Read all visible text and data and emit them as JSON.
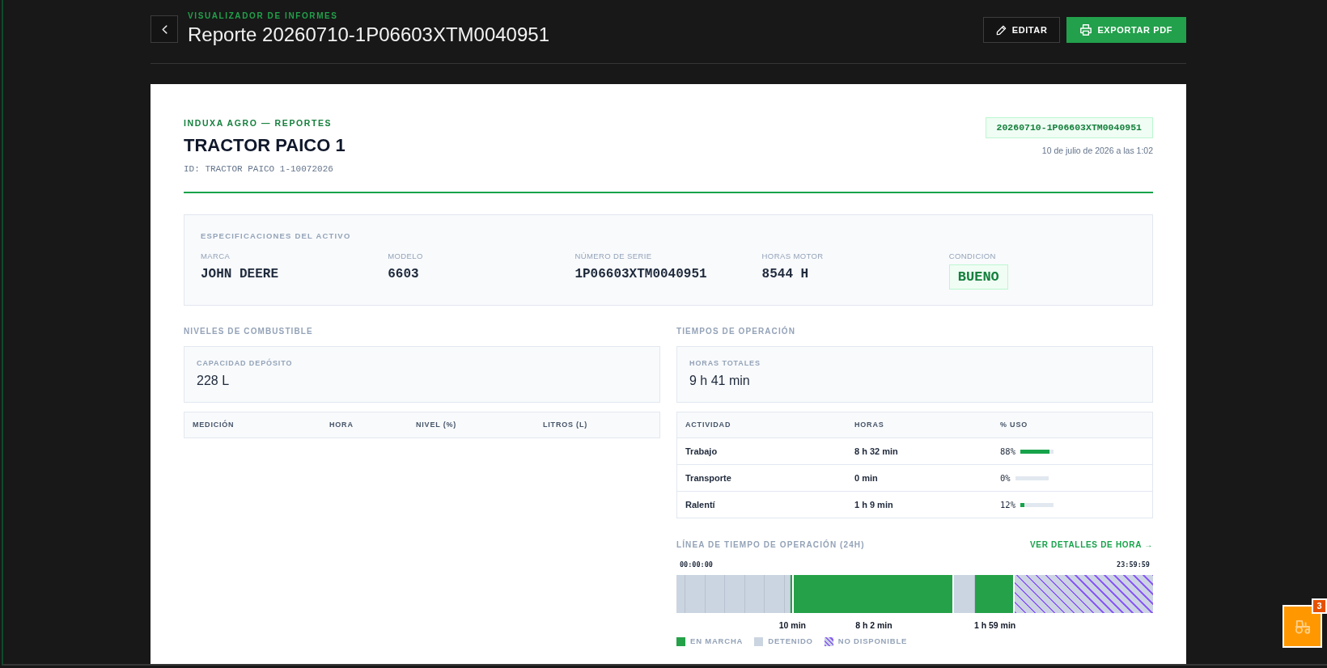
{
  "header": {
    "subtitle": "VISUALIZADOR DE INFORMES",
    "title": "Reporte 20260710-1P06603XTM0040951",
    "actions": [
      {
        "kind": "edit",
        "label": "EDITAR"
      },
      {
        "kind": "export",
        "label": "EXPORTAR PDF"
      }
    ]
  },
  "report": {
    "brand": "INDUXA AGRO — REPORTES",
    "asset_name": "TRACTOR PAICO 1",
    "asset_id": "ID: TRACTOR PAICO 1-10072026",
    "report_code": "20260710-1P06603XTM0040951",
    "date": "10 de julio de 2026 a las 1:02"
  },
  "specs": {
    "title": "ESPECIFICACIONES DEL ACTIVO",
    "fields": [
      {
        "kind": "text",
        "label": "MARCA",
        "value": "JOHN DEERE"
      },
      {
        "kind": "text",
        "label": "MODELO",
        "value": "6603"
      },
      {
        "kind": "text",
        "label": "NÚMERO DE SERIE",
        "value": "1P06603XTM0040951"
      },
      {
        "kind": "text",
        "label": "HORAS MOTOR",
        "value": "8544 H"
      },
      {
        "kind": "badge",
        "label": "CONDICION",
        "value": "BUENO"
      }
    ]
  },
  "fuel": {
    "title": "NIVELES DE COMBUSTIBLE",
    "summary": {
      "label": "CAPACIDAD DEPÓSITO",
      "value": "228 L"
    },
    "table": {
      "columns": [
        "MEDICIÓN",
        "HORA",
        "NIVEL (%)",
        "LITROS (L)"
      ]
    }
  },
  "operations": {
    "title": "TIEMPOS DE OPERACIÓN",
    "summary": {
      "label": "HORAS TOTALES",
      "value": "9 h 41 min"
    },
    "table": {
      "columns": [
        "ACTIVIDAD",
        "HORAS",
        "% USO"
      ],
      "rows": [
        {
          "activity": "Trabajo",
          "hours": "8 h 32 min",
          "usage": "88%",
          "level": 0.88
        },
        {
          "activity": "Transporte",
          "hours": "0 min",
          "usage": "0%",
          "level": 0
        },
        {
          "activity": "Ralentí",
          "hours": "1 h 9 min",
          "usage": "12%",
          "level": 0.12
        }
      ]
    }
  },
  "timeline": {
    "title": "LÍNEA DE TIEMPO DE OPERACIÓN (24H)",
    "details_link": "VER DETALLES DE HORA →",
    "start_time": "00:00:00",
    "end_time": "23:59:59",
    "segments": [
      {
        "kind": "stopped"
      },
      {
        "kind": "stopped"
      },
      {
        "kind": "stopped"
      },
      {
        "kind": "stopped"
      },
      {
        "kind": "stopped"
      },
      {
        "kind": "stopped"
      },
      {
        "kind": "stopped"
      },
      {
        "kind": "running",
        "label": "10 min"
      },
      {
        "kind": "running",
        "label": "8 h 2 min"
      },
      {
        "kind": "stopped"
      },
      {
        "kind": "running",
        "label": "1 h 59 min"
      },
      {
        "kind": "unavailable"
      }
    ],
    "legend": [
      {
        "kind": "running",
        "label": "EN MARCHA"
      },
      {
        "kind": "stopped",
        "label": "DETENIDO"
      },
      {
        "kind": "unavailable",
        "label": "NO DISPONIBLE"
      }
    ]
  },
  "notifications": {
    "count": "3"
  }
}
